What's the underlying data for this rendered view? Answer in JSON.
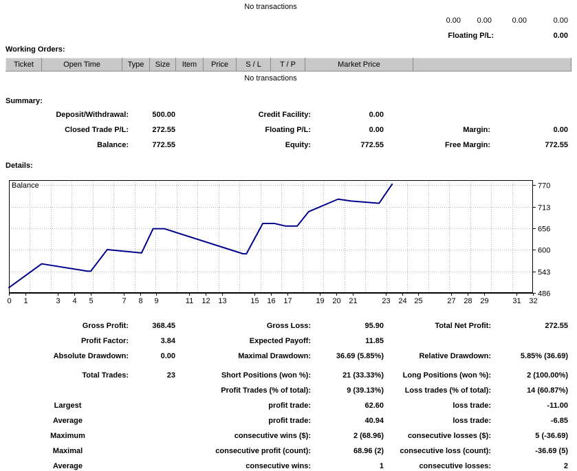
{
  "open_trades": {
    "empty_text": "No transactions",
    "totals_row": [
      "0.00",
      "0.00",
      "0.00",
      "0.00"
    ],
    "floating_pl_label": "Floating P/L:",
    "floating_pl_value": "0.00"
  },
  "working_orders": {
    "heading": "Working Orders:",
    "columns": [
      "Ticket",
      "Open Time",
      "Type",
      "Size",
      "Item",
      "Price",
      "S / L",
      "T / P",
      "Market Price",
      ""
    ],
    "empty_text": "No transactions"
  },
  "summary": {
    "heading": "Summary:",
    "rows": [
      {
        "a_label": "Deposit/Withdrawal:",
        "a_value": "500.00",
        "b_label": "Credit Facility:",
        "b_value": "0.00",
        "c_label": "",
        "c_value": ""
      },
      {
        "a_label": "Closed Trade P/L:",
        "a_value": "272.55",
        "b_label": "Floating P/L:",
        "b_value": "0.00",
        "c_label": "Margin:",
        "c_value": "0.00"
      },
      {
        "a_label": "Balance:",
        "a_value": "772.55",
        "b_label": "Equity:",
        "b_value": "772.55",
        "c_label": "Free Margin:",
        "c_value": "772.55"
      }
    ]
  },
  "details": {
    "heading": "Details:",
    "rows": [
      {
        "a_label": "Gross Profit:",
        "a_value": "368.45",
        "b_label": "Gross Loss:",
        "b_value": "95.90",
        "c_label": "Total Net Profit:",
        "c_value": "272.55"
      },
      {
        "a_label": "Profit Factor:",
        "a_value": "3.84",
        "b_label": "Expected Payoff:",
        "b_value": "11.85",
        "c_label": "",
        "c_value": ""
      },
      {
        "a_label": "Absolute Drawdown:",
        "a_value": "0.00",
        "b_label": "Maximal Drawdown:",
        "b_value": "36.69 (5.85%)",
        "c_label": "Relative Drawdown:",
        "c_value": "5.85% (36.69)"
      },
      {
        "a_label": "Total Trades:",
        "a_value": "23",
        "b_label": "Short Positions (won %):",
        "b_value": "21 (33.33%)",
        "c_label": "Long Positions (won %):",
        "c_value": "2 (100.00%)"
      },
      {
        "a_label": "",
        "a_value": "",
        "b_label": "Profit Trades (% of total):",
        "b_value": "9 (39.13%)",
        "c_label": "Loss trades (% of total):",
        "c_value": "14 (60.87%)"
      },
      {
        "a_label": "Largest",
        "a_value": "",
        "b_label": "profit trade:",
        "b_value": "62.60",
        "c_label": "loss trade:",
        "c_value": "-11.00"
      },
      {
        "a_label": "Average",
        "a_value": "",
        "b_label": "profit trade:",
        "b_value": "40.94",
        "c_label": "loss trade:",
        "c_value": "-6.85"
      },
      {
        "a_label": "Maximum",
        "a_value": "",
        "b_label": "consecutive wins ($):",
        "b_value": "2 (68.96)",
        "c_label": "consecutive losses ($):",
        "c_value": "5 (-36.69)"
      },
      {
        "a_label": "Maximal",
        "a_value": "",
        "b_label": "consecutive profit (count):",
        "b_value": "68.96 (2)",
        "c_label": "consecutive loss (count):",
        "c_value": "-36.69 (5)"
      },
      {
        "a_label": "Average",
        "a_value": "",
        "b_label": "consecutive wins:",
        "b_value": "1",
        "c_label": "consecutive losses:",
        "c_value": "2"
      }
    ]
  },
  "chart_data": {
    "type": "line",
    "title": "",
    "series_label": "Balance",
    "xlabel": "",
    "ylabel": "",
    "line_color": "#00008b",
    "grid": true,
    "legend_position": "top-left",
    "xlim": [
      0,
      32
    ],
    "ylim": [
      486,
      783
    ],
    "y_ticks": [
      770,
      713,
      656,
      600,
      543,
      486
    ],
    "x_ticks": [
      0,
      1,
      3,
      4,
      5,
      7,
      8,
      9,
      11,
      12,
      13,
      15,
      16,
      17,
      19,
      20,
      21,
      23,
      24,
      25,
      27,
      28,
      29,
      31,
      32
    ],
    "x": [
      0,
      2,
      4.8,
      5,
      6,
      8.1,
      8.8,
      9.5,
      14.3,
      14.5,
      15.5,
      16.2,
      16.9,
      17.6,
      18.3,
      20.1,
      20.9,
      22.6,
      23.4
    ],
    "values": [
      500.0,
      562.6,
      543.3,
      543.3,
      600.0,
      591.3,
      655.0,
      655.0,
      589.0,
      589.0,
      669.0,
      669.0,
      662.0,
      662.0,
      700.0,
      733.0,
      728.0,
      722.0,
      772.55
    ],
    "points": [
      {
        "trade": 0,
        "balance": 500.0
      },
      {
        "trade": 2,
        "balance": 562.6
      },
      {
        "trade": 4.8,
        "balance": 543.3
      },
      {
        "trade": 6,
        "balance": 600.0
      },
      {
        "trade": 8.1,
        "balance": 591.3
      },
      {
        "trade": 9,
        "balance": 655.0
      },
      {
        "trade": 14.3,
        "balance": 589.0
      },
      {
        "trade": 15.4,
        "balance": 669.0
      },
      {
        "trade": 16.8,
        "balance": 662.0
      },
      {
        "trade": 20.1,
        "balance": 733.0
      },
      {
        "trade": 22.6,
        "balance": 722.0
      },
      {
        "trade": 23.4,
        "balance": 772.55
      }
    ]
  }
}
